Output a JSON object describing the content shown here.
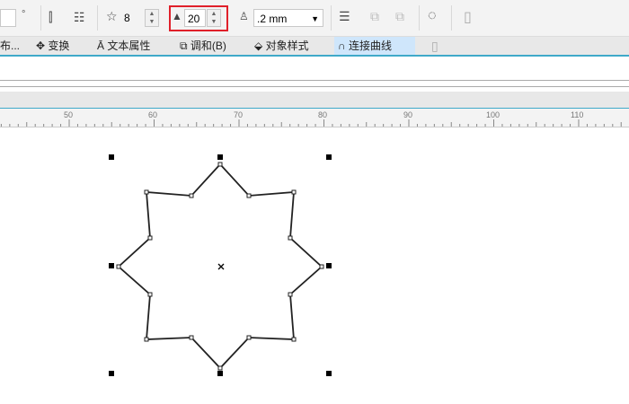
{
  "toolbar": {
    "angle_unit": "°",
    "points_label_icon": "star-icon",
    "points": "8",
    "sharpness": "20",
    "outline_width": ".2 mm",
    "highlight_color": "#e0202a"
  },
  "tabs": [
    {
      "label": "布..."
    },
    {
      "label": "变换"
    },
    {
      "label": "文本属性"
    },
    {
      "label": "调和(B)"
    },
    {
      "label": "对象样式"
    },
    {
      "label": "连接曲线"
    }
  ],
  "ruler": {
    "labels": [
      "50",
      "60",
      "70",
      "80",
      "90",
      "100",
      "110"
    ]
  }
}
